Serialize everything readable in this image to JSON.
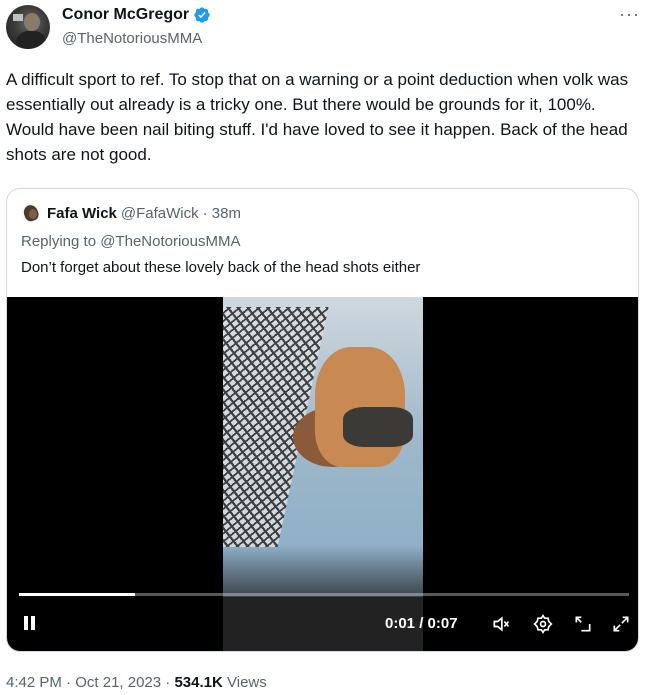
{
  "tweet": {
    "author_name": "Conor McGregor",
    "author_handle": "@TheNotoriousMMA",
    "text": "A difficult sport to ref. To stop that on a warning or a point deduction when volk was essentially out already is a tricky one. But there would be grounds for it, 100%. Would have been nail biting stuff. I'd have loved to see it happen. Back of the head shots are not good.",
    "time": "4:42 PM",
    "date": "Oct 21, 2023",
    "views_count": "534.1K",
    "views_label": "Views",
    "sep": "·"
  },
  "quoted": {
    "author_name": "Fafa Wick",
    "author_handle": "@FafaWick",
    "age": "· 38m",
    "replying_to": "Replying to @TheNotoriousMMA",
    "text": "Don’t forget about these lovely back of the head shots either"
  },
  "video": {
    "current_time": "0:01",
    "duration": "0:07",
    "progress_fraction": 0.19
  },
  "icons": {
    "more": "more-icon",
    "verified": "verified-badge-icon",
    "pause": "pause-icon",
    "mute": "mute-icon",
    "settings": "settings-icon",
    "pip": "pip-icon",
    "fullscreen": "fullscreen-icon"
  },
  "colors": {
    "verified": "#1d9bf0",
    "secondary_text": "#536471",
    "border": "#cfd9de"
  }
}
